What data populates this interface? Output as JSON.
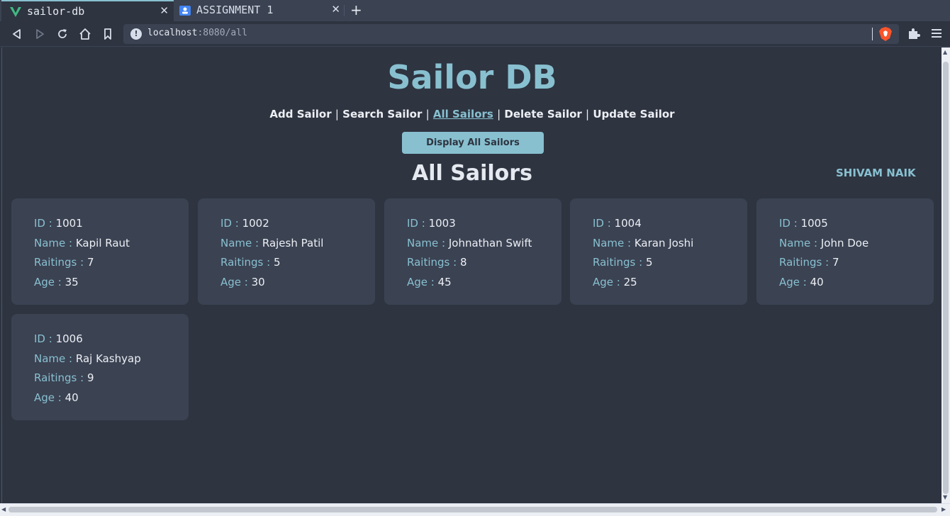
{
  "browser": {
    "tabs": [
      {
        "label": "sailor-db",
        "icon": "vue-logo-icon",
        "active": true
      },
      {
        "label": "ASSIGNMENT 1",
        "icon": "classroom-icon",
        "active": false
      }
    ],
    "url": {
      "host": "localhost",
      "rest": ":8080/all"
    }
  },
  "page": {
    "title": "Sailor DB",
    "nav": [
      {
        "label": "Add Sailor",
        "current": false
      },
      {
        "label": "Search Sailor",
        "current": false
      },
      {
        "label": "All Sailors",
        "current": true
      },
      {
        "label": "Delete Sailor",
        "current": false
      },
      {
        "label": "Update Sailor",
        "current": false
      }
    ],
    "nav_separator": "|",
    "display_button": "Display All Sailors",
    "section_title": "All Sailors",
    "author": "SHIVAM NAIK",
    "field_labels": {
      "id": "ID :",
      "name": "Name :",
      "rating": "Raitings :",
      "age": "Age :"
    },
    "sailors": [
      {
        "id": "1001",
        "name": "Kapil Raut",
        "rating": "7",
        "age": "35"
      },
      {
        "id": "1002",
        "name": "Rajesh Patil",
        "rating": "5",
        "age": "30"
      },
      {
        "id": "1003",
        "name": "Johnathan Swift",
        "rating": "8",
        "age": "45"
      },
      {
        "id": "1004",
        "name": "Karan Joshi",
        "rating": "5",
        "age": "25"
      },
      {
        "id": "1005",
        "name": "John Doe",
        "rating": "7",
        "age": "40"
      },
      {
        "id": "1006",
        "name": "Raj Kashyap",
        "rating": "9",
        "age": "40"
      }
    ]
  },
  "colors": {
    "accent": "#88c0d0",
    "background": "#2e3440",
    "card": "#3b4252",
    "text": "#eceff4"
  }
}
